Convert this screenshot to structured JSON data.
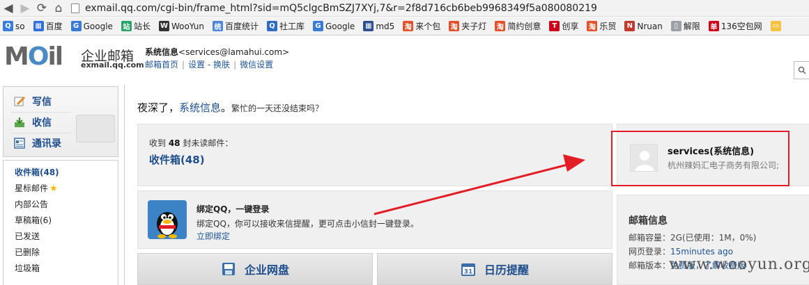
{
  "browser": {
    "url": "exmail.qq.com/cgi-bin/frame_html?sid=mQ5clgcBmSZJ7XYj,7&r=2f8d716cb6beb9968349f5a080080219",
    "bookmarks": [
      {
        "label": "so",
        "color": "#3b7ddd",
        "glyph": "Q"
      },
      {
        "label": "百度",
        "color": "#2e6fdb",
        "glyph": "▦"
      },
      {
        "label": "Google",
        "color": "#3a7bd5",
        "glyph": "G"
      },
      {
        "label": "站长",
        "color": "#2aa36b",
        "glyph": "站"
      },
      {
        "label": "WooYun",
        "color": "#333333",
        "glyph": "W"
      },
      {
        "label": "百度统计",
        "color": "#4f86d9",
        "glyph": "统"
      },
      {
        "label": "社工库",
        "color": "#2d6cc0",
        "glyph": "Q"
      },
      {
        "label": "Google",
        "color": "#3a7bd5",
        "glyph": "G"
      },
      {
        "label": "md5",
        "color": "#2b4f8f",
        "glyph": "▦"
      },
      {
        "label": "来个包",
        "color": "#e4512a",
        "glyph": "淘"
      },
      {
        "label": "夹子灯",
        "color": "#e4512a",
        "glyph": "淘"
      },
      {
        "label": "简约创意",
        "color": "#e4512a",
        "glyph": "淘"
      },
      {
        "label": "创享",
        "color": "#d0021b",
        "glyph": "T"
      },
      {
        "label": "乐贸",
        "color": "#e4512a",
        "glyph": "淘"
      },
      {
        "label": "Nruan",
        "color": "#c0392b",
        "glyph": "N"
      },
      {
        "label": "解限",
        "color": "#9aa0a6",
        "glyph": "▯"
      },
      {
        "label": "136空包网",
        "color": "#d0021b",
        "glyph": "单"
      },
      {
        "label": "",
        "color": "#f5c342",
        "glyph": "▭"
      }
    ]
  },
  "header": {
    "logo_main": "MOil",
    "logo_cn": "企业邮箱",
    "logo_en": "exmail.qq.com",
    "account_name": "系统信息",
    "account_email": "<services@lamahui.com>",
    "links": [
      "邮箱首页",
      "设置",
      "换肤",
      "微信设置"
    ],
    "skin_sep": " - "
  },
  "sidebar": {
    "quick": [
      {
        "label": "写信",
        "icon": "compose-icon"
      },
      {
        "label": "收信",
        "icon": "receive-icon"
      },
      {
        "label": "通讯录",
        "icon": "contacts-icon"
      }
    ],
    "folders": [
      {
        "label": "收件箱(48)",
        "active": true
      },
      {
        "label": "星标邮件",
        "star": true
      },
      {
        "label": "内部公告"
      },
      {
        "label": "草稿箱(6)"
      },
      {
        "label": "已发送"
      },
      {
        "label": "已删除"
      },
      {
        "label": "垃圾箱"
      }
    ]
  },
  "main": {
    "greeting": "夜深了，",
    "greeting_name": "系统信息",
    "greeting_end": "。",
    "greeting_sub": "繁忙的一天还没结束吗？",
    "inbox_pre": "收到 ",
    "inbox_count": "48",
    "inbox_post": " 封未读邮件：",
    "inbox_link": "收件箱(48)",
    "qq_title": "绑定QQ，一键登录",
    "qq_desc": "绑定QQ，你可以接收来信提醒，更可点击小信封一键登录。",
    "qq_bind": "立即绑定",
    "btn_disk": "企业网盘",
    "btn_calendar": "日历提醒",
    "calendar_day": "31"
  },
  "user_card": {
    "name": "services(系统信息)",
    "org": "杭州辣妈汇电子商务有限公司;"
  },
  "mailbox_info": {
    "title": "邮箱信息",
    "capacity_label": "邮箱容量：",
    "capacity_value": "2G(已使用：1M，0%)",
    "web_login_label": "网页登录：",
    "web_login_value": "15minutes ago",
    "version_label": "邮箱版本：",
    "version_value": "免费版，了解收费版"
  },
  "watermark": "www.wooyun.org",
  "colors": {
    "link": "#1e4e8c",
    "highlight_box": "#e31d25",
    "arrow": "#e31d25"
  }
}
